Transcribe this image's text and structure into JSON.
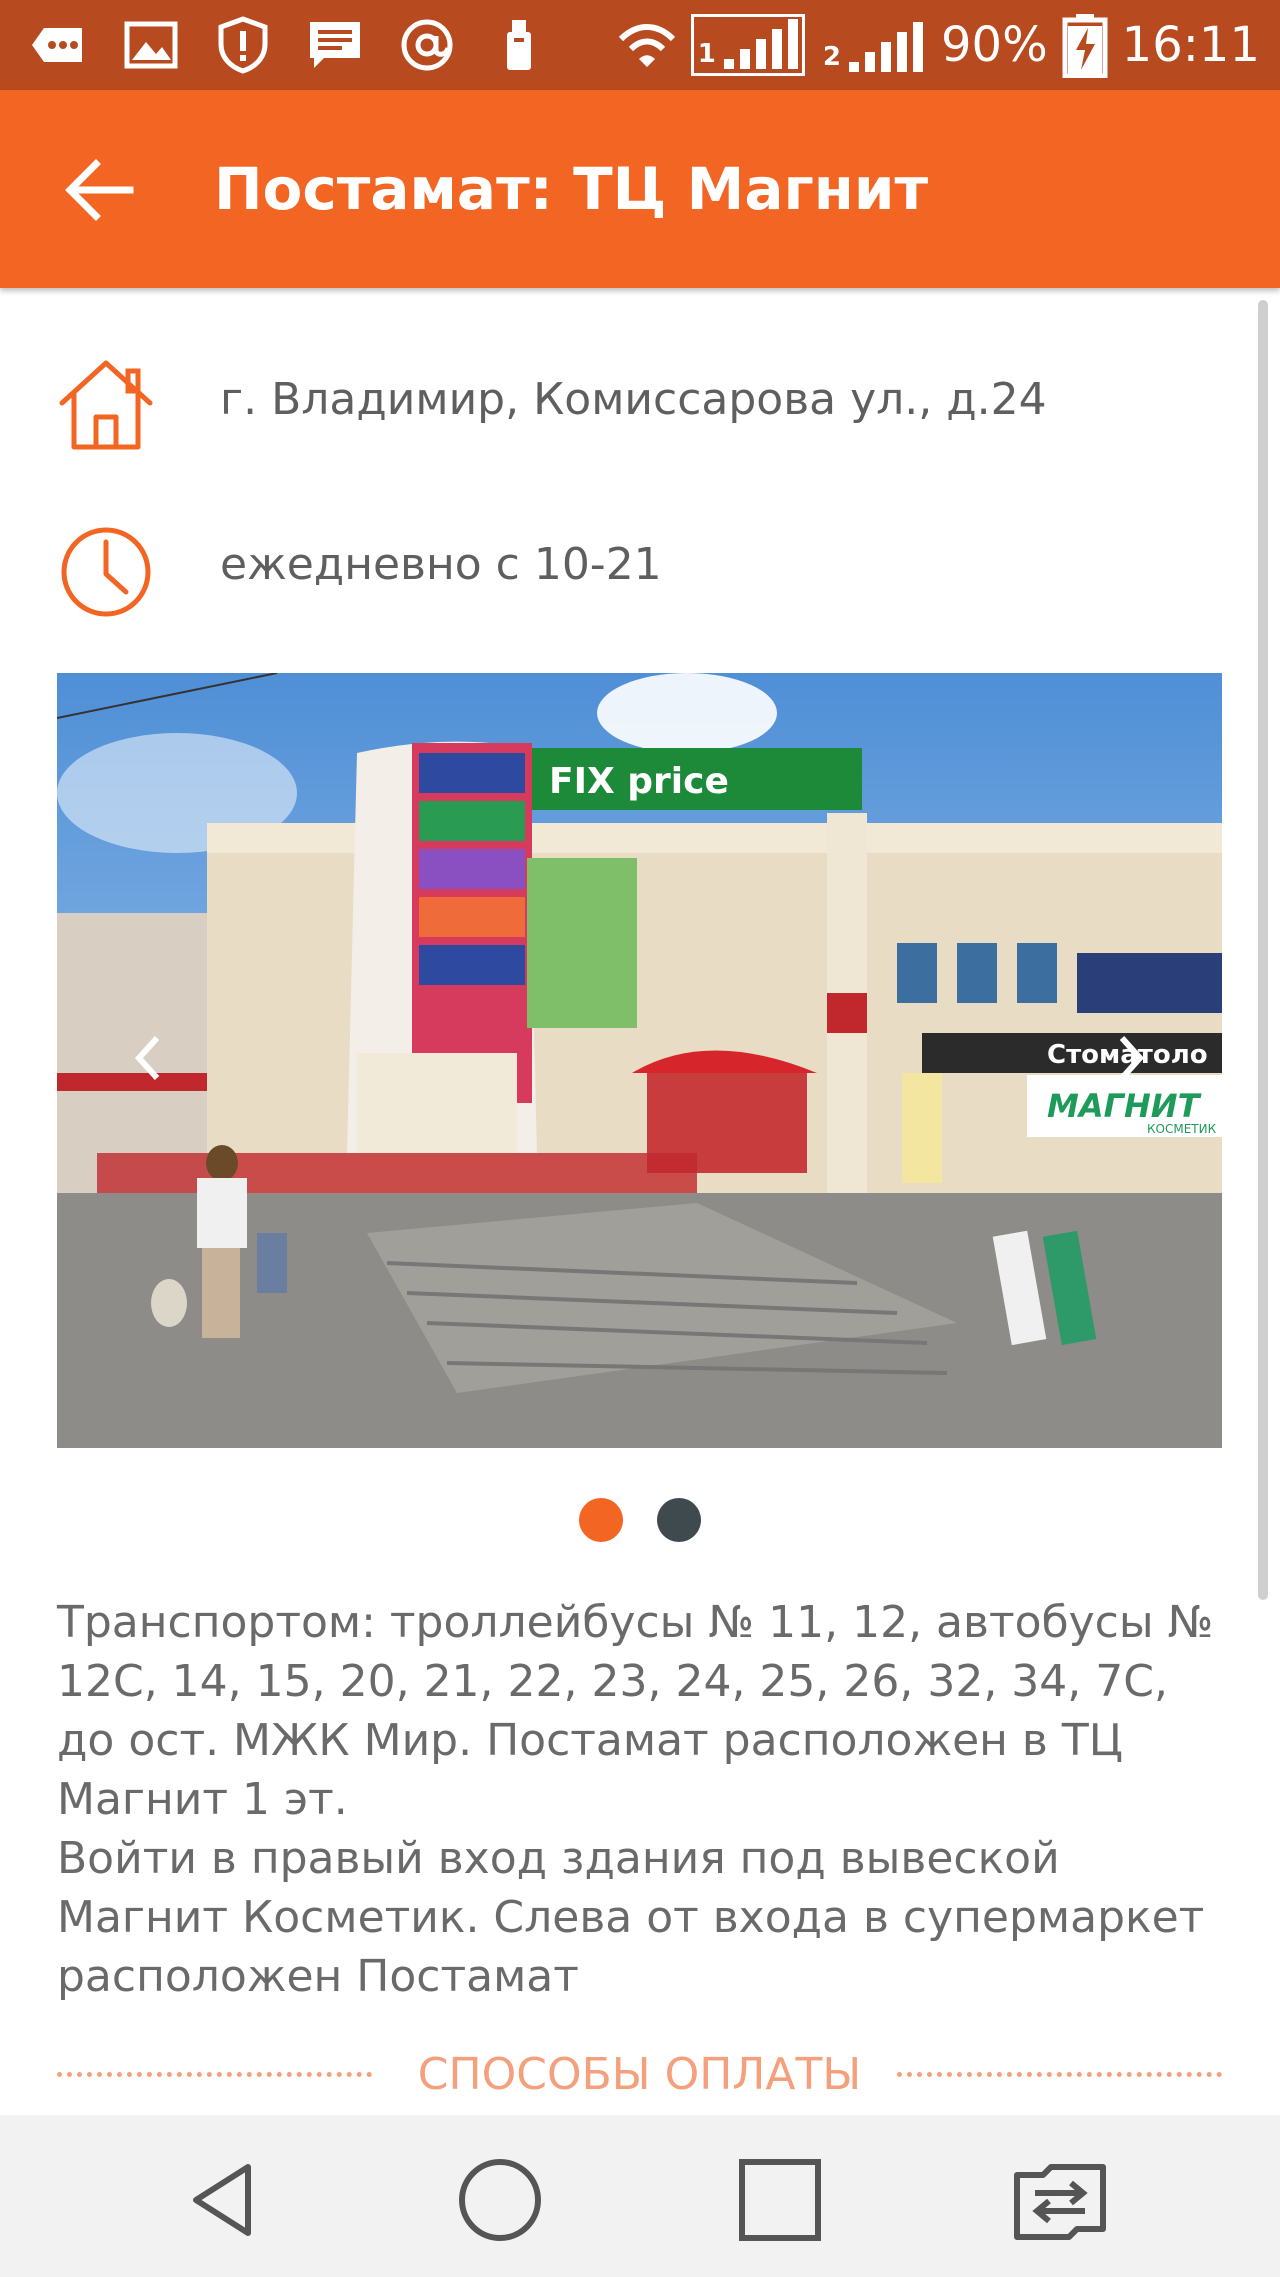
{
  "status_bar": {
    "battery_percent": "90%",
    "time": "16:11",
    "sim1_label": "1",
    "sim2_label": "2",
    "icons": [
      "messages-icon",
      "gallery-icon",
      "shield-icon",
      "sms-icon",
      "at-icon",
      "usb-icon",
      "wifi-icon",
      "signal-sim1-icon",
      "signal-sim2-icon",
      "battery-charging-icon"
    ]
  },
  "app_bar": {
    "title": "Постамат: ТЦ Магнит",
    "back_icon": "arrow-back-icon"
  },
  "info": {
    "address": "г. Владимир, Комиссарова ул., д.24",
    "address_icon": "home-icon",
    "hours": "ежедневно с 10-21",
    "hours_icon": "clock-icon"
  },
  "carousel": {
    "slide_count": 2,
    "active_index": 0,
    "sign_fixprice": "FIX price",
    "sign_stomatology": "Стоматоло",
    "sign_magnit": "МАГНИТ",
    "sign_kosmetik": "КОСМЕТИК"
  },
  "description": {
    "paragraph1": "Транспортом: троллейбусы № 11, 12, автобусы № 12С, 14, 15, 20, 21, 22, 23, 24, 25, 26, 32, 34, 7С, до ост. МЖК Мир. Постамат расположен в ТЦ Магнит 1 эт.",
    "paragraph2": "Войти в правый вход здания под вывеской Магнит Косметик. Слева от входа в супермаркет расположен Постамат"
  },
  "payment": {
    "label": "СПОСОБЫ ОПЛАТЫ"
  },
  "colors": {
    "accent": "#f26522",
    "status_bar": "#b84a20",
    "text": "#5f5f5f",
    "dot_inactive": "#3f4a4f",
    "payment_label": "#f4a07c"
  },
  "nav_bar": {
    "icons": [
      "nav-back-icon",
      "nav-home-icon",
      "nav-recents-icon",
      "nav-switch-sim-icon"
    ]
  }
}
